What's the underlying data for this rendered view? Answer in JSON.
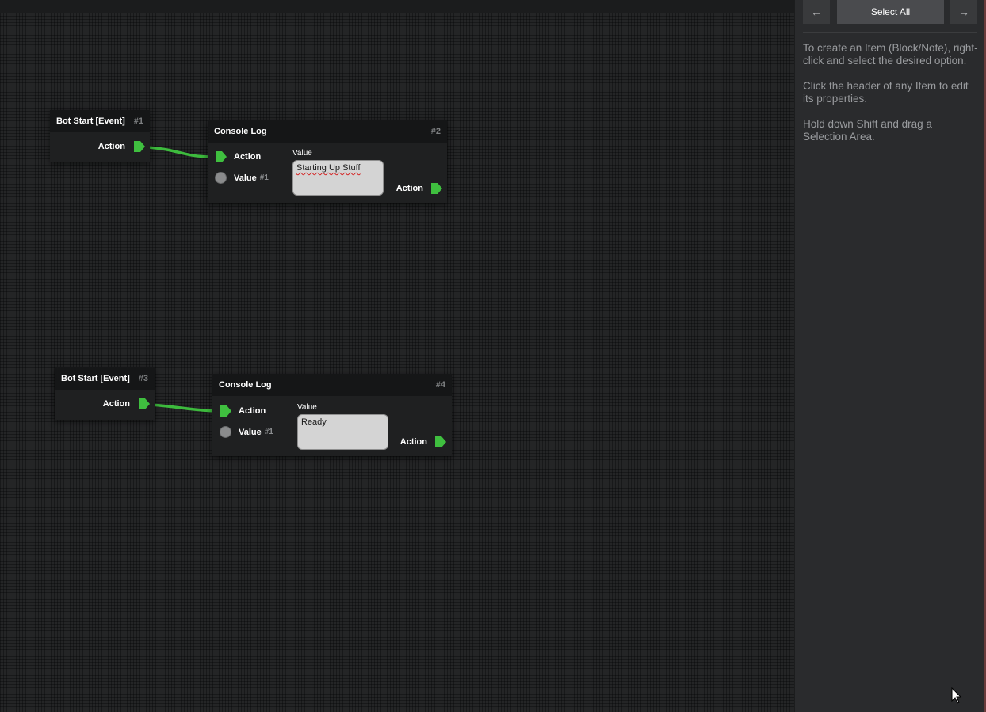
{
  "sidebar": {
    "prev_icon": "←",
    "next_icon": "→",
    "select_all_label": "Select All",
    "help_lines": [
      "To create an Item (Block/Note), right-click and select the desired option.",
      "Click the header of any Item to edit its properties.",
      "Hold down Shift and drag a Selection Area."
    ]
  },
  "blocks": [
    {
      "title": "Bot Start [Event]",
      "id": "#1",
      "output_label": "Action"
    },
    {
      "title": "Console Log",
      "id": "#2",
      "input_action_label": "Action",
      "input_value_label": "Value",
      "input_value_ref": "#1",
      "value_caption": "Value",
      "value_text": "Starting Up Stuff",
      "output_label": "Action"
    },
    {
      "title": "Bot Start [Event]",
      "id": "#3",
      "output_label": "Action"
    },
    {
      "title": "Console Log",
      "id": "#4",
      "input_action_label": "Action",
      "input_value_label": "Value",
      "input_value_ref": "#1",
      "value_caption": "Value",
      "value_text": "Ready",
      "output_label": "Action"
    }
  ],
  "colors": {
    "action_port": "#3fbf3f",
    "wire": "#3dbb3d",
    "canvas_bg": "#242526"
  }
}
